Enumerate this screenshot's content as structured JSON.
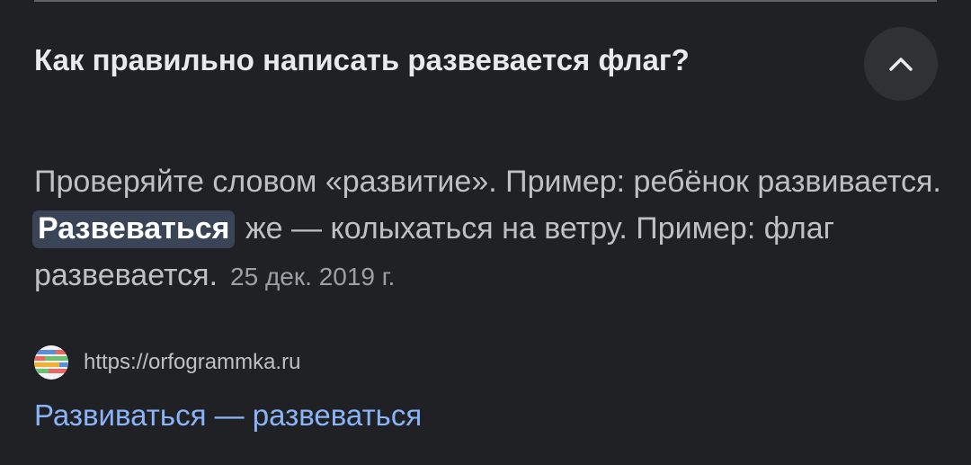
{
  "question": {
    "text": "Как правильно написать развевается флаг?",
    "collapse_icon": "chevron-up-icon"
  },
  "answer": {
    "part1": "Проверяйте словом «развитие». Пример: ребёнок развивается.",
    "highlight": "Развеваться",
    "part2": "же — колыхаться на ветру. Пример: флаг развевается.",
    "date": "25 дек. 2019 г."
  },
  "source": {
    "favicon": "orfogrammka-favicon",
    "url": "https://orfogrammka.ru",
    "title": "Развиваться — развеваться"
  },
  "colors": {
    "background": "#202124",
    "link": "#8ab4f8",
    "highlight_bg": "#394457"
  }
}
